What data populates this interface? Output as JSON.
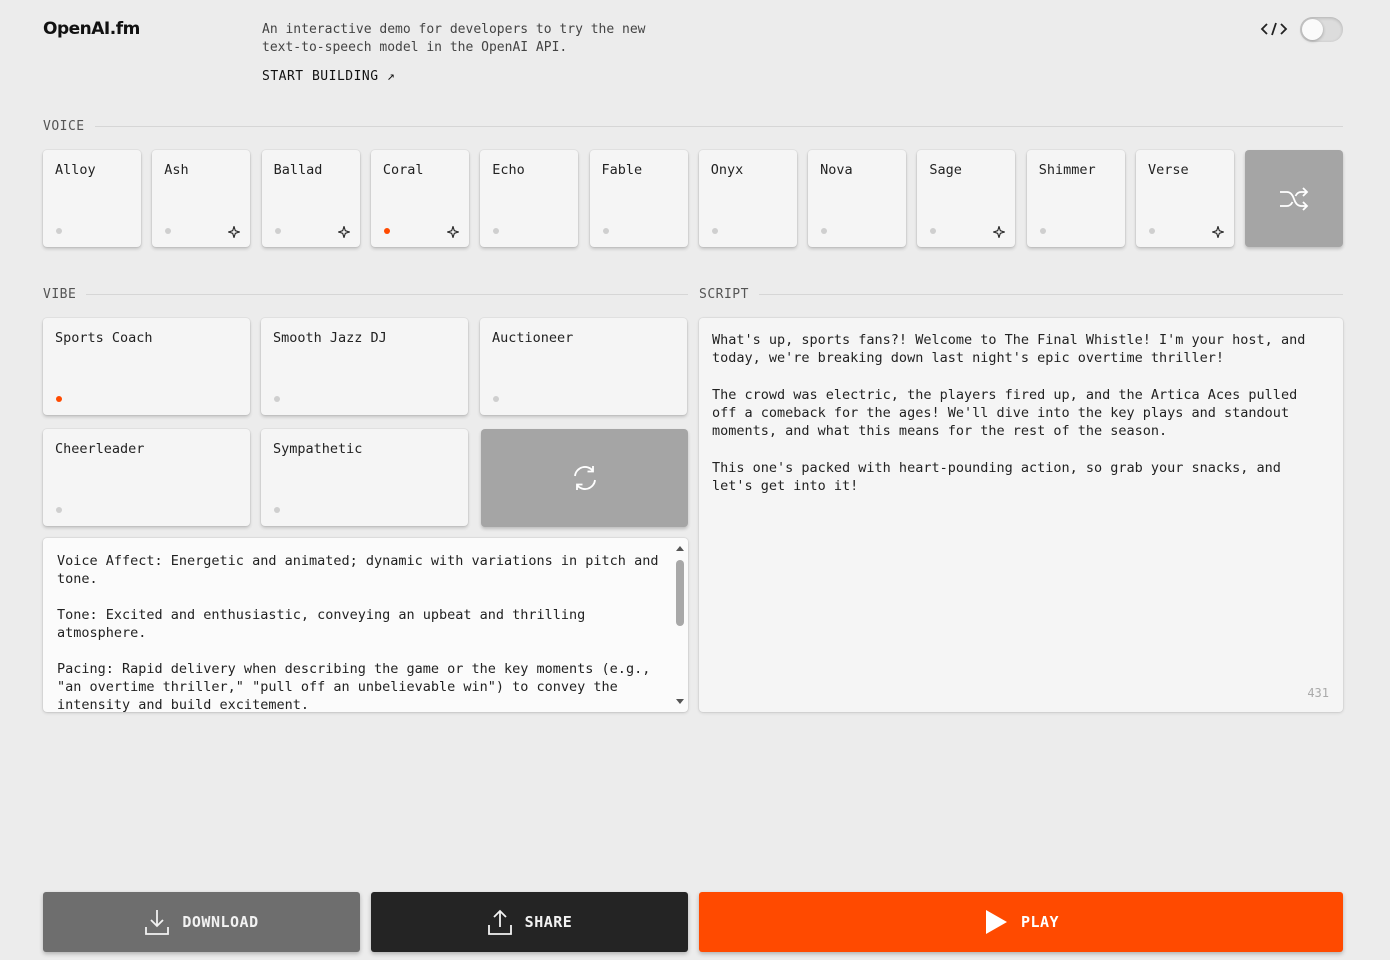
{
  "header": {
    "logo": "OpenAI.fm",
    "tagline": "An interactive demo for developers to try the new text-to-speech model in the OpenAI API.",
    "start_link": "START BUILDING ↗",
    "code_icon": "code-icon"
  },
  "voice": {
    "section_label": "VOICE",
    "items": [
      {
        "label": "Alloy",
        "selected": false,
        "new": false
      },
      {
        "label": "Ash",
        "selected": false,
        "new": true
      },
      {
        "label": "Ballad",
        "selected": false,
        "new": true
      },
      {
        "label": "Coral",
        "selected": true,
        "new": true
      },
      {
        "label": "Echo",
        "selected": false,
        "new": false
      },
      {
        "label": "Fable",
        "selected": false,
        "new": false
      },
      {
        "label": "Onyx",
        "selected": false,
        "new": false
      },
      {
        "label": "Nova",
        "selected": false,
        "new": false
      },
      {
        "label": "Sage",
        "selected": false,
        "new": true
      },
      {
        "label": "Shimmer",
        "selected": false,
        "new": false
      },
      {
        "label": "Verse",
        "selected": false,
        "new": true
      }
    ],
    "shuffle_icon": "shuffle-icon"
  },
  "vibe": {
    "section_label": "VIBE",
    "items": [
      {
        "label": "Sports Coach",
        "selected": true
      },
      {
        "label": "Smooth Jazz DJ",
        "selected": false
      },
      {
        "label": "Auctioneer",
        "selected": false
      },
      {
        "label": "Cheerleader",
        "selected": false
      },
      {
        "label": "Sympathetic",
        "selected": false
      }
    ],
    "refresh_icon": "refresh-icon",
    "instructions": "Voice Affect: Energetic and animated; dynamic with variations in pitch and tone.\n\nTone: Excited and enthusiastic, conveying an upbeat and thrilling atmosphere.\n\nPacing: Rapid delivery when describing the game or the key moments (e.g., \"an overtime thriller,\" \"pull off an unbelievable win\") to convey the intensity and build excitement."
  },
  "script": {
    "section_label": "SCRIPT",
    "text": "What's up, sports fans?! Welcome to The Final Whistle! I'm your host, and today, we're breaking down last night's epic overtime thriller!\n\nThe crowd was electric, the players fired up, and the Artica Aces pulled off a comeback for the ages! We'll dive into the key plays and standout moments, and what this means for the rest of the season.\n\nThis one's packed with heart-pounding action, so grab your snacks, and let's get into it!",
    "char_count": "431"
  },
  "actions": {
    "download_label": "DOWNLOAD",
    "share_label": "SHARE",
    "play_label": "PLAY"
  },
  "colors": {
    "accent": "#ff4a00",
    "background": "#ececec",
    "card": "#f5f5f5"
  }
}
